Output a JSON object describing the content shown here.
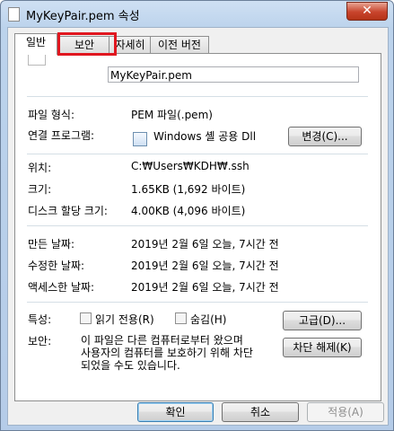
{
  "window": {
    "title": "MyKeyPair.pem 속성",
    "close_glyph": "✕"
  },
  "tabs": [
    {
      "label": "일반"
    },
    {
      "label": "보안"
    },
    {
      "label": "자세히"
    },
    {
      "label": "이전 버전"
    }
  ],
  "general": {
    "file_name": "MyKeyPair.pem",
    "type_label": "파일 형식:",
    "type_value": "PEM 파일(.pem)",
    "opens_with_label": "연결 프로그램:",
    "opens_with_value": "Windows 셸 공용 Dll",
    "change_button": "변경(C)...",
    "location_label": "위치:",
    "location_value": "C:₩Users₩KDH₩.ssh",
    "size_label": "크기:",
    "size_value": "1.65KB (1,692 바이트)",
    "size_on_disk_label": "디스크 할당 크기:",
    "size_on_disk_value": "4.00KB (4,096 바이트)",
    "created_label": "만든 날짜:",
    "created_value": "2019년 2월 6일 오늘, 7시간 전",
    "modified_label": "수정한 날짜:",
    "modified_value": "2019년 2월 6일 오늘, 7시간 전",
    "accessed_label": "액세스한 날짜:",
    "accessed_value": "2019년 2월 6일 오늘, 7시간 전",
    "attributes_label": "특성:",
    "readonly_label": "읽기 전용(R)",
    "hidden_label": "숨김(H)",
    "advanced_button": "고급(D)...",
    "security_label": "보안:",
    "security_text_1": "이 파일은 다른 컴퓨터로부터 왔으며",
    "security_text_2": "사용자의 컴퓨터를 보호하기 위해 차단",
    "security_text_3": "되었을 수도 있습니다.",
    "unblock_button": "차단 해제(K)"
  },
  "footer": {
    "ok_button": "확인",
    "cancel_button": "취소",
    "apply_button": "적용(A)"
  }
}
